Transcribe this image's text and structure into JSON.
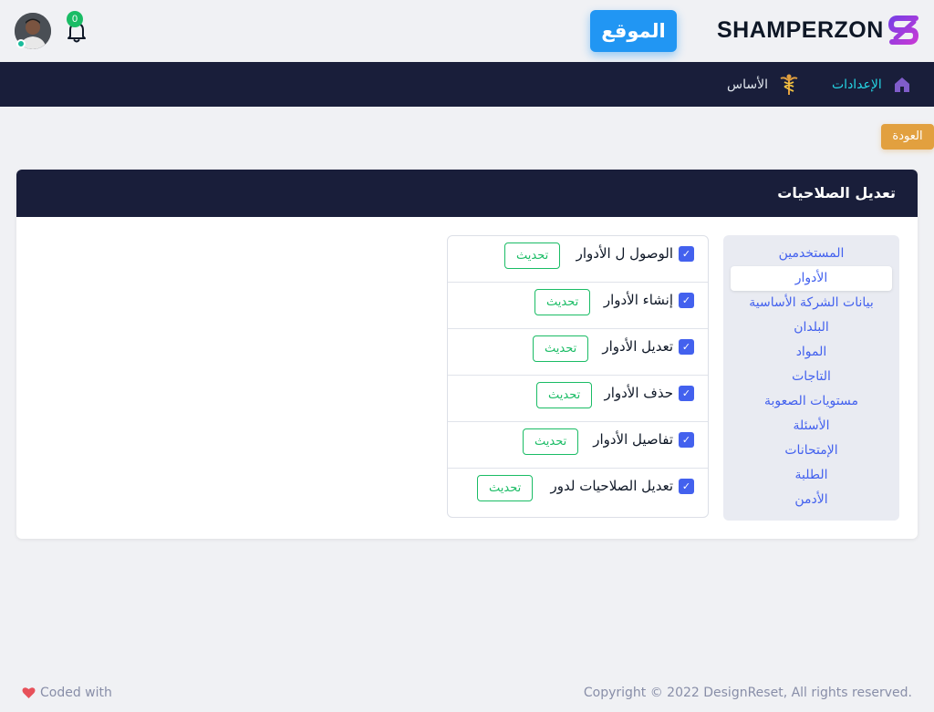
{
  "header": {
    "brand": "SHAMPERZON",
    "site_button": "الموقع",
    "notification_count": "0"
  },
  "nav": {
    "settings": "الإعدادات",
    "base": "الأساس"
  },
  "back_button": "العودة",
  "card": {
    "title": "تعديل الصلاحيات"
  },
  "sidebar": {
    "items": [
      {
        "label": "المستخدمين"
      },
      {
        "label": "الأدوار"
      },
      {
        "label": "بيانات الشركة الأساسية"
      },
      {
        "label": "البلدان"
      },
      {
        "label": "المواد"
      },
      {
        "label": "التاجات"
      },
      {
        "label": "مستويات الصعوبة"
      },
      {
        "label": "الأسئلة"
      },
      {
        "label": "الإمتحانات"
      },
      {
        "label": "الطلبة"
      },
      {
        "label": "الأدمن"
      }
    ],
    "active_index": 1
  },
  "permissions": {
    "update_label": "تحديث",
    "items": [
      {
        "label": "الوصول ل الأدوار",
        "checked": true
      },
      {
        "label": "إنشاء الأدوار",
        "checked": true
      },
      {
        "label": "تعديل الأدوار",
        "checked": true
      },
      {
        "label": "حذف الأدوار",
        "checked": true
      },
      {
        "label": "تفاصيل الأدوار",
        "checked": true
      },
      {
        "label": "تعديل الصلاحيات لدور",
        "checked": true
      }
    ]
  },
  "footer": {
    "copyright": "Copyright © 2022 DesignReset, All rights reserved.",
    "coded_with": "Coded with"
  },
  "colors": {
    "navy": "#191e3a",
    "primary": "#4361ee",
    "success": "#1abc65",
    "warning": "#e2a03f",
    "info": "#2196f3"
  }
}
